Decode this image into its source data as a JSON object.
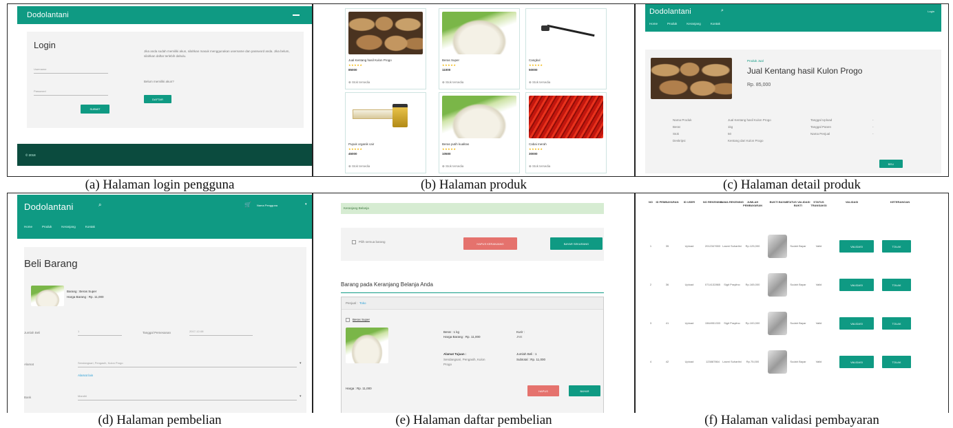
{
  "captions": {
    "a": "(a)   Halaman login pengguna",
    "b": "(b)   Halaman produk",
    "c": "(c)   Halaman detail produk",
    "d": "(d) Halaman pembelian",
    "e": "(e) Halaman daftar pembelian",
    "f": "(f) Halaman validasi pembayaran"
  },
  "brand": "Dodolantani",
  "login": {
    "title": "Login",
    "username_ph": "Username",
    "password_ph": "Password",
    "submit": "SUBMIT",
    "info": "Jika anda sudah memiliki akun, silahkan masuk menggunakan username dan password anda. Jika belum, silahkan daftar terlebih dahulu.",
    "register_q": "Belum memiliki akun?",
    "register_btn": "DAFTAR",
    "footer": "© 2018"
  },
  "products": [
    {
      "name": "Jual Kentang hasil Kulon Progo",
      "price": "85000"
    },
    {
      "name": "Beras Super",
      "price": "11000"
    },
    {
      "name": "Cangkul",
      "price": "50000"
    },
    {
      "name": "Pupuk organik cair",
      "price": "45000"
    },
    {
      "name": "Beras putih kualitas",
      "price": "10500"
    },
    {
      "name": "Cabai merah",
      "price": "30000"
    }
  ],
  "product_meta": "Stok tersedia",
  "detail": {
    "menu": [
      "Home",
      "Produk",
      "Keranjang",
      "Kontak"
    ],
    "category": "Produk Jual",
    "title": "Jual Kentang hasil Kulon Progo",
    "price": "Rp. 85,000",
    "login": "Login",
    "rows": [
      [
        "Nama Produk",
        "Jual Kentang hasil Kulon Progo",
        "Tanggal Upload",
        "-"
      ],
      [
        "Berat",
        "1kg",
        "Tanggal Panen",
        "-"
      ],
      [
        "Stok",
        "50",
        "Nama Penjual",
        "-"
      ],
      [
        "Deskripsi",
        "Kentang dari Kulon Progo",
        "",
        ""
      ]
    ],
    "btn": "BELI"
  },
  "pembelian": {
    "menu": [
      "Home",
      "Produk",
      "Keranjang",
      "Kontak"
    ],
    "title": "Beli Barang",
    "item_line1": "Barang : Beras Super",
    "item_line2": "Harga Barang : Rp. 11,000",
    "jumlah_label": "Jumlah Beli",
    "jumlah_val": "1",
    "tanggal_label": "Tanggal Pemesanan",
    "tanggal_val": "2017-12-08",
    "alamat_label": "Alamat",
    "alamat_val": "Sendangsari, Pengasih, Kulon Progo",
    "alamat_link": "Alamat lain",
    "bank_label": "Bank",
    "bank_val": "Mandiri",
    "user": "Nama Pengguna"
  },
  "daftar": {
    "alert": "Keranjang Belanja",
    "hapus": "HAPUS KERANJANG",
    "checkout": "BAYAR SEKARANG",
    "select_all": "Pilih semua barang",
    "heading": "Barang pada Keranjang Belanja Anda",
    "toko_label": "Penjual :",
    "toko_name": "Toko",
    "item": "Beras Super",
    "berat": "Berat : 1 kg",
    "harga": "Harga Barang : Rp. 11,000",
    "tujuan_label": "Alamat Tujuan :",
    "tujuan": "Sendangsari, Pengasih, Kulon Progo",
    "kurir_label": "Kurir :",
    "kurir": "JNE",
    "jumlah": "Jumlah Beli : 1",
    "subtotal": "Subtotal : Rp. 11,000",
    "total": "Harga : Rp. 11,000",
    "hapus_btn": "HAPUS",
    "bayar_btn": "BAYAR"
  },
  "validasi": {
    "headers": [
      "NO",
      "ID PEMBAYARAN",
      "ID USER",
      "NO REKENING",
      "NAMA REKENING",
      "JUMLAH PEMBAYARAN",
      "BUKTI BAYAR",
      "STATUS VALIDASI BUKTI",
      "STATUS TRANSAKSI",
      "VALIDASI",
      "KETERANGAN"
    ],
    "rows": [
      [
        "1",
        "35",
        "Upload",
        "2012347653",
        "Lasmi Suhartini",
        "Rp.125,000",
        "Sudah Bayar",
        "Valid"
      ],
      [
        "2",
        "36",
        "Upload",
        "0714132865",
        "Sigit Prayitno",
        "Rp.165,000",
        "Sudah Bayar",
        "Valid"
      ],
      [
        "3",
        "41",
        "Upload",
        "1564951333",
        "Sigit Prayitno",
        "Rp.100,000",
        "Sudah Bayar",
        "Valid"
      ],
      [
        "4",
        "42",
        "Upload",
        "123887864",
        "Lasmi Suhartini",
        "Rp.75,000",
        "Sudah Bayar",
        "Valid"
      ]
    ],
    "validasi_btn": "VALIDASI",
    "tolak_btn": "TOLAK"
  },
  "colors": {
    "primary": "#0f9a83",
    "danger": "#e5726d",
    "footer": "#0b4b3e"
  }
}
